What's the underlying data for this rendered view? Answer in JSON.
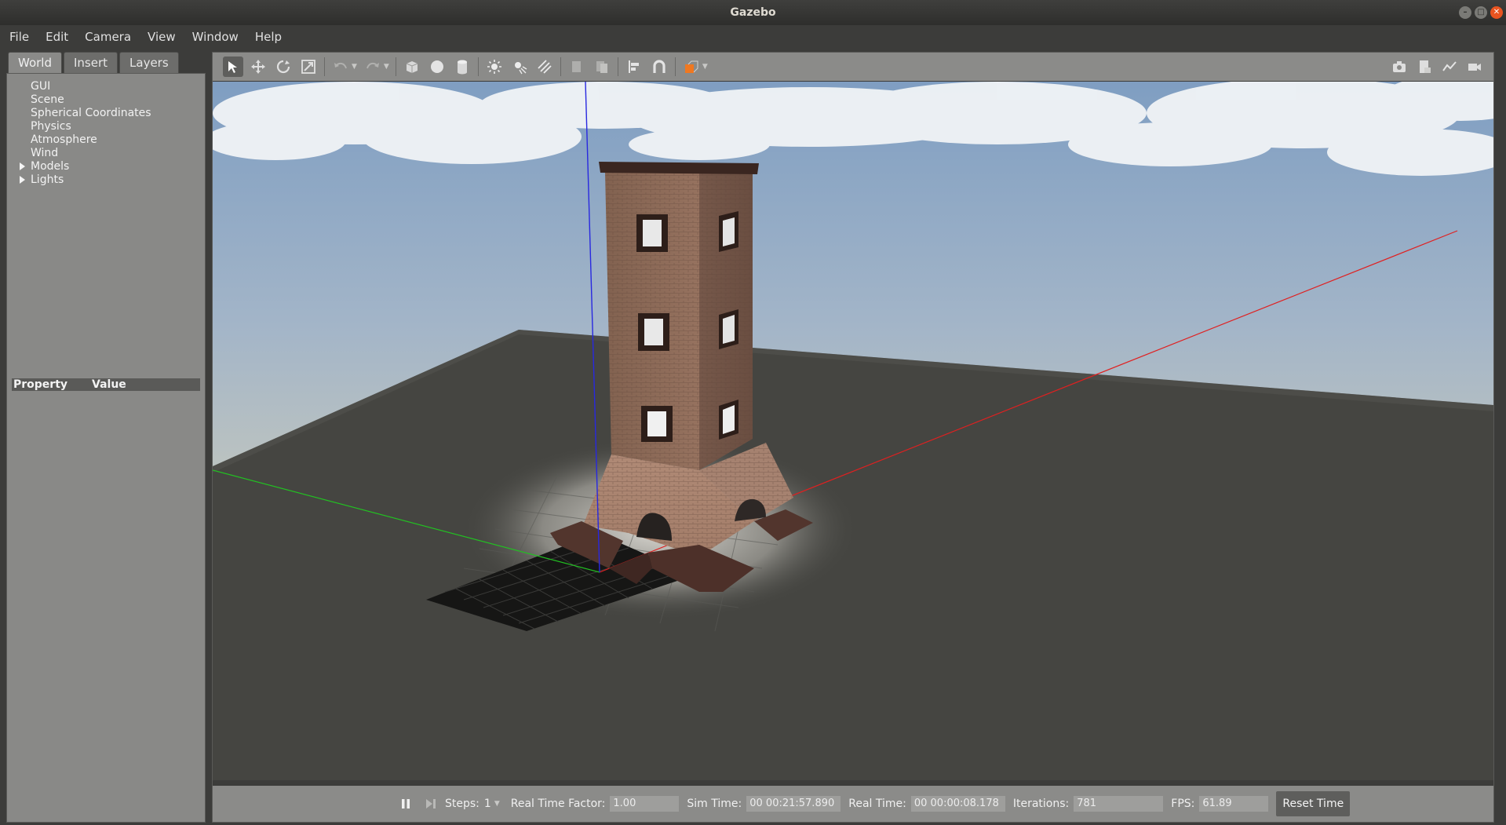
{
  "window": {
    "title": "Gazebo"
  },
  "menu": [
    "File",
    "Edit",
    "Camera",
    "View",
    "Window",
    "Help"
  ],
  "left_panel": {
    "tabs": [
      "World",
      "Insert",
      "Layers"
    ],
    "active_tab": "World",
    "tree": [
      {
        "label": "GUI",
        "expandable": false
      },
      {
        "label": "Scene",
        "expandable": false
      },
      {
        "label": "Spherical Coordinates",
        "expandable": false
      },
      {
        "label": "Physics",
        "expandable": false
      },
      {
        "label": "Atmosphere",
        "expandable": false
      },
      {
        "label": "Wind",
        "expandable": false
      },
      {
        "label": "Models",
        "expandable": true
      },
      {
        "label": "Lights",
        "expandable": true
      }
    ],
    "property_header": {
      "property": "Property",
      "value": "Value"
    }
  },
  "toolbar": {
    "tools": [
      "select-mode",
      "translate-mode",
      "rotate-mode",
      "scale-mode",
      "undo",
      "redo",
      "box-shape",
      "sphere-shape",
      "cylinder-shape",
      "point-light",
      "spot-light",
      "directional-light",
      "copy",
      "paste",
      "align",
      "snap",
      "change-view"
    ],
    "right_tools": [
      "screenshot",
      "log-data",
      "plot",
      "record-video"
    ]
  },
  "bottom_bar": {
    "steps_label": "Steps:",
    "steps_value": "1",
    "rtf_label": "Real Time Factor:",
    "rtf_value": "1.00",
    "sim_time_label": "Sim Time:",
    "sim_time_value": "00 00:21:57.890",
    "real_time_label": "Real Time:",
    "real_time_value": "00 00:00:08.178",
    "iterations_label": "Iterations:",
    "iterations_value": "781",
    "fps_label": "FPS:",
    "fps_value": "61.89",
    "reset_label": "Reset Time"
  },
  "colors": {
    "x_axis": "#e02020",
    "y_axis": "#20c020",
    "z_axis": "#2020e0",
    "ground": "#454540",
    "brick": "#8a6a58"
  }
}
